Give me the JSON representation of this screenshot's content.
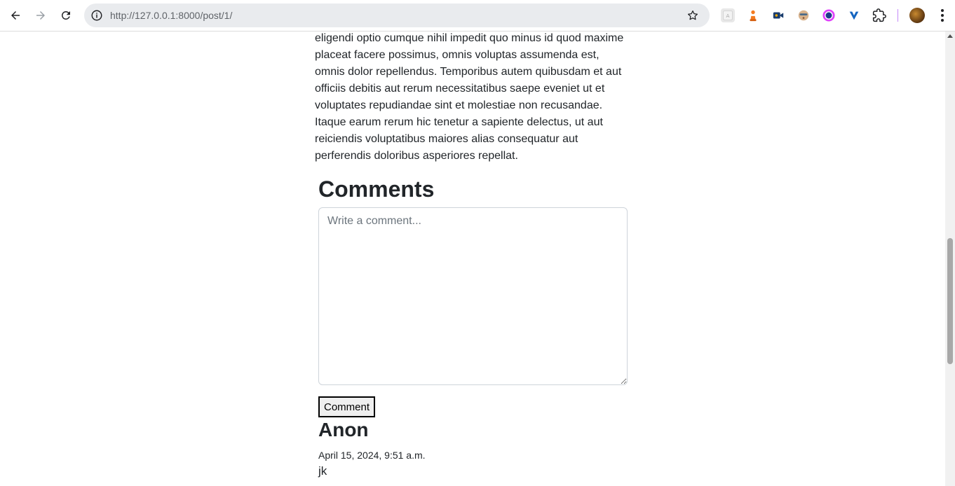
{
  "browser": {
    "url": "http://127.0.0.1:8000/post/1/",
    "extensions": [
      "translate-icon",
      "chess-icon",
      "video-camera-icon",
      "face-icon",
      "color-circle-icon",
      "vpn-icon",
      "puzzle-icon"
    ]
  },
  "post": {
    "body": "eligendi optio cumque nihil impedit quo minus id quod maxime placeat facere possimus, omnis voluptas assumenda est, omnis dolor repellendus. Temporibus autem quibusdam et aut officiis debitis aut rerum necessitatibus saepe eveniet ut et voluptates repudiandae sint et molestiae non recusandae. Itaque earum rerum hic tenetur a sapiente delectus, ut aut reiciendis voluptatibus maiores alias consequatur aut perferendis doloribus asperiores repellat."
  },
  "comments": {
    "heading": "Comments",
    "input_placeholder": "Write a comment...",
    "input_value": "",
    "submit_label": "Comment",
    "items": [
      {
        "author": "Anon",
        "date": "April 15, 2024, 9:51 a.m.",
        "text": "jk"
      }
    ]
  }
}
